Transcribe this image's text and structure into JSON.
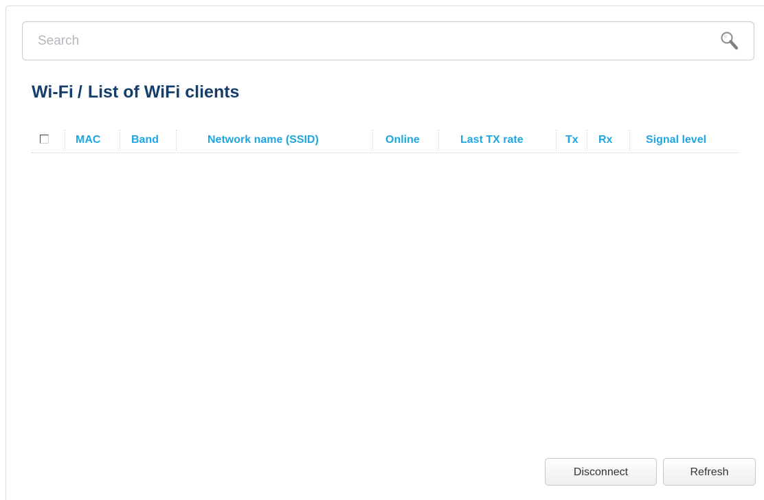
{
  "search": {
    "placeholder": "Search",
    "value": ""
  },
  "breadcrumb": {
    "section": "Wi-Fi",
    "separator": "/",
    "page": "List of WiFi clients"
  },
  "table": {
    "columns": [
      "MAC",
      "Band",
      "Network name (SSID)",
      "Online",
      "Last TX rate",
      "Tx",
      "Rx",
      "Signal level"
    ],
    "select_all_checked": false,
    "rows": []
  },
  "buttons": {
    "disconnect": "Disconnect",
    "refresh": "Refresh"
  },
  "colors": {
    "title": "#163e6b",
    "column_header": "#1fa6e0"
  }
}
